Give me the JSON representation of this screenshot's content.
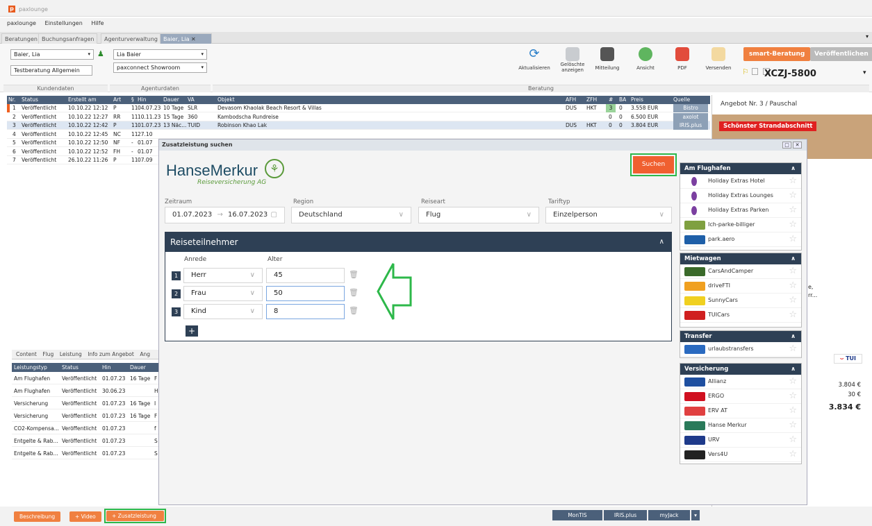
{
  "app": {
    "title": "paxlounge",
    "logo": "p"
  },
  "menu": [
    "paxlounge",
    "Einstellungen",
    "Hilfe"
  ],
  "tabs": [
    "Beratungen",
    "Buchungsanfragen",
    "Agenturverwaltung",
    "Baier, Lia"
  ],
  "toolbar": {
    "kunde": "Baier, Lia",
    "beratung": "Testberatung Allgemein",
    "agent": "Lia Baier",
    "agentur": "paxconnect Showroom",
    "kundendaten": "Kundendaten",
    "agenturdaten": "Agenturdaten",
    "beratung_label": "Beratung",
    "buttons": [
      "Aktualisieren",
      "Gelöschte anzeigen",
      "Mitteilung",
      "Ansicht",
      "PDF",
      "Versenden"
    ],
    "smart": "smart-Beratung",
    "veroeff": "Veröffentlichen",
    "code": "XCZJ-5800"
  },
  "table": {
    "headers": [
      "Nr.",
      "Status",
      "Erstellt am",
      "Art",
      "§",
      "Hin",
      "Dauer",
      "VA",
      "Objekt",
      "AFH",
      "ZFH",
      "#",
      "BA",
      "Preis",
      "Quelle"
    ],
    "rows": [
      [
        "1",
        "Veröffentlicht",
        "10.10.22 12:12",
        "P",
        "11",
        "04.07.23",
        "10 Tage",
        "SLR",
        "Devasom Khaolak Beach Resort & Villas",
        "DUS",
        "HKT",
        "3",
        "0",
        "3.558 EUR",
        "Bistro"
      ],
      [
        "2",
        "Veröffentlicht",
        "10.10.22 12:27",
        "RR",
        "11",
        "10.11.23",
        "15 Tage",
        "360",
        "Kambodscha Rundreise",
        "",
        "",
        "0",
        "0",
        "6.500 EUR",
        "axolot"
      ],
      [
        "3",
        "Veröffentlicht",
        "10.10.22 12:42",
        "P",
        "11",
        "01.07.23",
        "13 Näc...",
        "TUID",
        "Robinson Khao Lak",
        "DUS",
        "HKT",
        "0",
        "0",
        "3.804 EUR",
        "IRIS.plus"
      ],
      [
        "4",
        "Veröffentlicht",
        "10.10.22 12:45",
        "NC",
        "11",
        "27.10",
        "",
        "",
        "",
        "",
        "",
        "",
        "",
        "",
        ""
      ],
      [
        "5",
        "Veröffentlicht",
        "10.10.22 12:50",
        "NF",
        "-",
        "01.07",
        "",
        "",
        "",
        "",
        "",
        "",
        "",
        "",
        ""
      ],
      [
        "6",
        "Veröffentlicht",
        "10.10.22 12:52",
        "FH",
        "-",
        "01.07",
        "",
        "",
        "",
        "",
        "",
        "",
        "",
        "",
        ""
      ],
      [
        "7",
        "Veröffentlicht",
        "26.10.22 11:26",
        "P",
        "11",
        "07.09",
        "",
        "",
        "",
        "",
        "",
        "",
        "",
        "",
        ""
      ]
    ]
  },
  "lowtabs": [
    "Content",
    "Flug",
    "Leistung",
    "Info zum Angebot",
    "Ang"
  ],
  "leistung": {
    "headers": [
      "Leistungstyp",
      "Status",
      "Hin",
      "Dauer",
      ""
    ],
    "rows": [
      [
        "Am Flughafen",
        "Veröffentlicht",
        "01.07.23",
        "16 Tage",
        "F"
      ],
      [
        "Am Flughafen",
        "Veröffentlicht",
        "30.06.23",
        "",
        "H"
      ],
      [
        "Versicherung",
        "Veröffentlicht",
        "01.07.23",
        "16 Tage",
        "I"
      ],
      [
        "Versicherung",
        "Veröffentlicht",
        "01.07.23",
        "16 Tage",
        "F"
      ],
      [
        "CO2-Kompensa...",
        "Veröffentlicht",
        "01.07.23",
        "",
        "f"
      ],
      [
        "Entgelte & Rab...",
        "Veröffentlicht",
        "01.07.23",
        "",
        "S"
      ],
      [
        "Entgelte & Rab...",
        "Veröffentlicht",
        "01.07.23",
        "",
        "S"
      ]
    ]
  },
  "bottom": {
    "beschreibung": "Beschreibung",
    "video": "+ Video",
    "zusatz": "+ Zusatzleistung",
    "montis": "MonTIS",
    "iris": "IRIS.plus",
    "myjack": "myJack"
  },
  "angebot": {
    "title": "Angebot Nr. 3 / Pauschal",
    "badge": "Schönster Strandabschnitt",
    "text1": "e,",
    "text2": "rr...",
    "p1": "3.804 €",
    "p2": "30 €",
    "total": "3.834 €",
    "tui": "TUI"
  },
  "dialog": {
    "title": "Zusatzleistung suchen",
    "brand": "HanseMerkur",
    "brand_sub": "Reiseversicherung AG",
    "suchen": "Suchen",
    "zeitraum_label": "Zeitraum",
    "from": "01.07.2023",
    "to": "16.07.2023",
    "arrow": "→",
    "region_label": "Region",
    "region": "Deutschland",
    "reiseart_label": "Reiseart",
    "reiseart": "Flug",
    "tarif_label": "Tariftyp",
    "tarif": "Einzelperson",
    "rt_title": "Reiseteilnehmer",
    "anrede_label": "Anrede",
    "alter_label": "Alter",
    "persons": [
      {
        "n": "1",
        "anrede": "Herr",
        "alter": "45"
      },
      {
        "n": "2",
        "anrede": "Frau",
        "alter": "50"
      },
      {
        "n": "3",
        "anrede": "Kind",
        "alter": "8"
      }
    ]
  },
  "side": [
    {
      "title": "Am Flughafen",
      "items": [
        "Holiday Extras Hotel",
        "Holiday Extras Lounges",
        "Holiday Extras Parken",
        "Ich-parke-billiger",
        "park.aero"
      ]
    },
    {
      "title": "Mietwagen",
      "items": [
        "CarsAndCamper",
        "driveFTI",
        "SunnyCars",
        "TUICars"
      ]
    },
    {
      "title": "Transfer",
      "items": [
        "urlaubstransfers"
      ]
    },
    {
      "title": "Versicherung",
      "items": [
        "Allianz",
        "ERGO",
        "ERV AT",
        "Hanse Merkur",
        "URV",
        "Vers4U"
      ]
    }
  ],
  "colors": {
    "accent": "#f08040",
    "navy": "#2e4055",
    "green": "#2db84a"
  }
}
